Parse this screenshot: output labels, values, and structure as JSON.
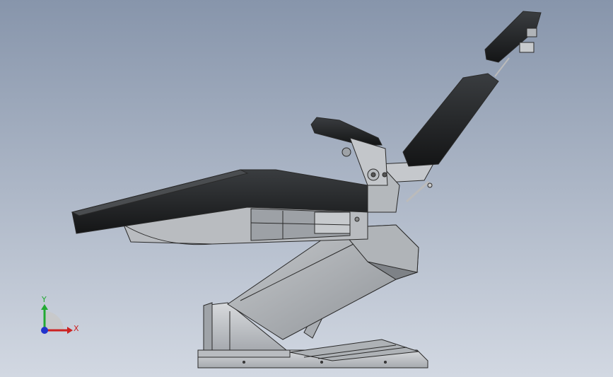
{
  "viewport": {
    "background_top": "#8795ab",
    "background_bottom": "#d2d8e2"
  },
  "model": {
    "upholstery_color": "#222426",
    "frame_color": "#c9cccf",
    "frame_dark_color": "#8a8e93",
    "edge_color": "#2a2a2a"
  },
  "triad": {
    "x_label": "X",
    "y_label": "Y",
    "x_color": "#cc2222",
    "y_color": "#22aa33",
    "z_color": "#2233cc"
  }
}
